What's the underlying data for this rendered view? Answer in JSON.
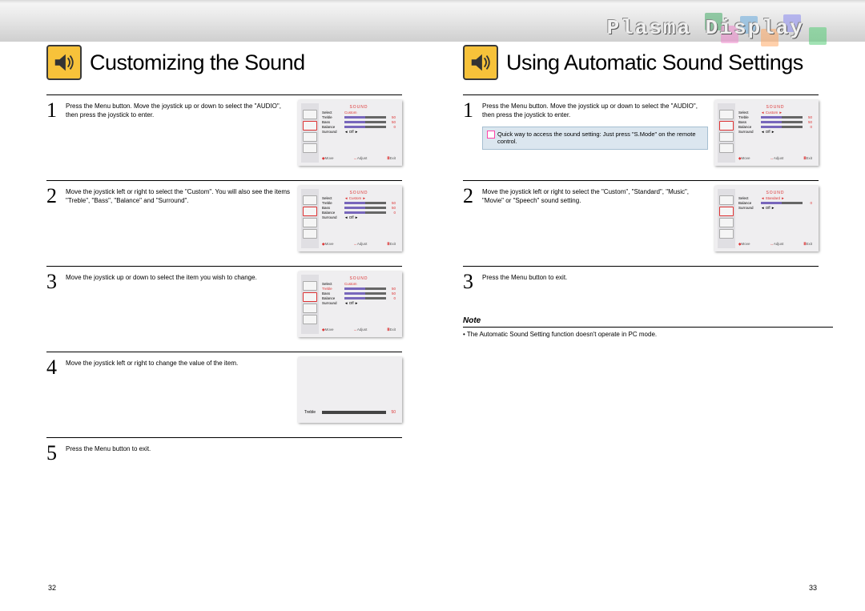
{
  "header": {
    "product_title": "Plasma Display"
  },
  "left": {
    "title": "Customizing the Sound",
    "steps": [
      "Press the Menu button. Move the joystick up or down to select the \"AUDIO\", then press the joystick to enter.",
      "Move the joystick left or right to select the \"Custom\". You will also see the items \"Treble\", \"Bass\", \"Balance\" and \"Surround\".",
      "Move the joystick up or down to select the item you wish to change.",
      "Move the joystick left or right to change the value of the item.",
      "Press the Menu button to exit."
    ],
    "page_num": "32"
  },
  "right": {
    "title": "Using Automatic Sound Settings",
    "steps": [
      "Press the Menu button. Move the joystick up or down to select the \"AUDIO\", then press the joystick to enter.",
      "Move the joystick left or right to select the \"Custom\", \"Standard\", \"Music\", \"Movie\" or \"Speech\" sound setting.",
      "Press the Menu button to exit."
    ],
    "tip": "Quick way to access the sound setting: Just press \"S.Mode\" on the remote control.",
    "note_heading": "Note",
    "note_body": "• The Automatic Sound Setting function doesn't operate in PC mode.",
    "page_num": "33"
  },
  "osd": {
    "menu_title": "SOUND",
    "select_label": "Select",
    "mode_custom": "Custom",
    "mode_standard": "Standard",
    "rows": [
      {
        "label": "Treble",
        "value": "50",
        "fill": 50
      },
      {
        "label": "Bass",
        "value": "50",
        "fill": 50
      },
      {
        "label": "Balance",
        "value": "0",
        "fill": 50
      },
      {
        "label": "Surround",
        "value": "Off",
        "fill": 0
      }
    ],
    "rows_short": [
      {
        "label": "Balance",
        "value": "0",
        "fill": 50
      },
      {
        "label": "Surround",
        "value": "Off",
        "fill": 0
      }
    ],
    "footer": {
      "move": "Move",
      "adjust": "Adjust",
      "exit": "Exit"
    },
    "slider": {
      "label": "Treble",
      "value": "50"
    }
  }
}
